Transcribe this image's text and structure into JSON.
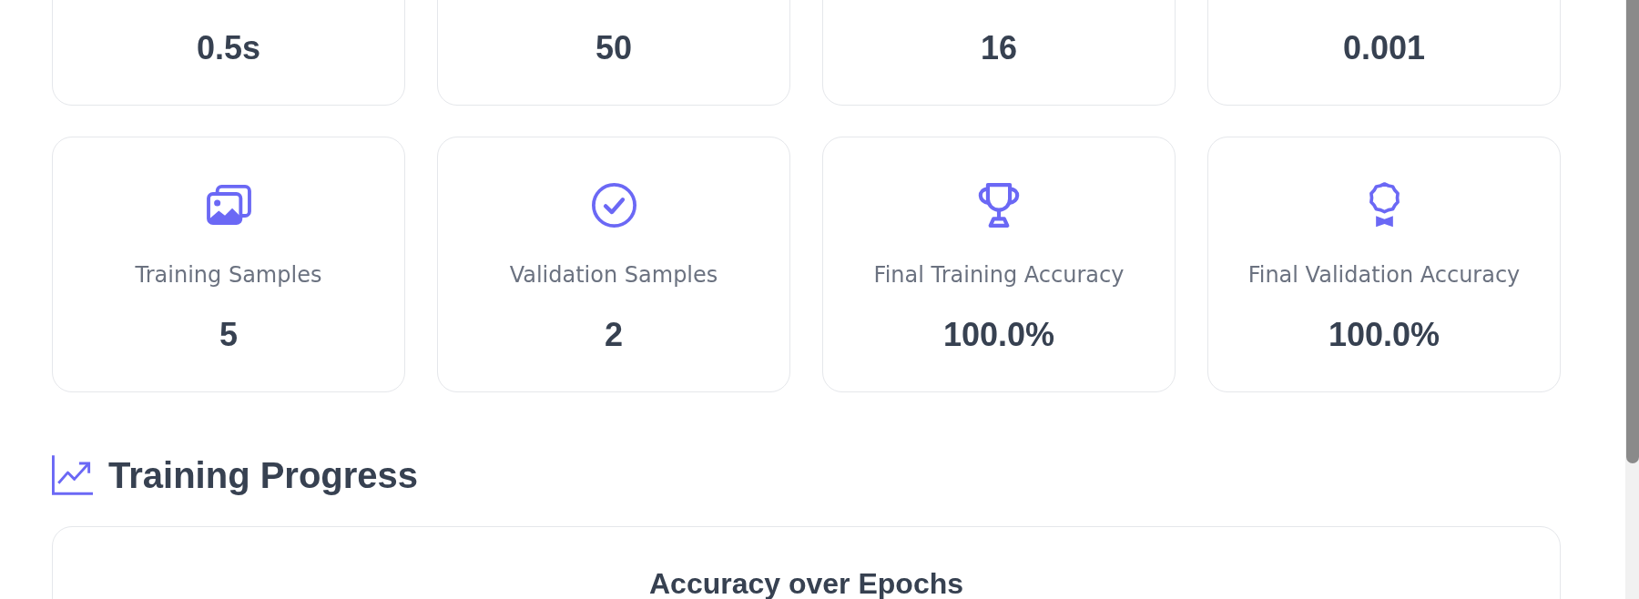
{
  "stat_cards_row_1": [
    {
      "value": "0.5s"
    },
    {
      "value": "50"
    },
    {
      "value": "16"
    },
    {
      "value": "0.001"
    }
  ],
  "stat_cards_row_2": [
    {
      "label": "Training Samples",
      "value": "5"
    },
    {
      "label": "Validation Samples",
      "value": "2"
    },
    {
      "label": "Final Training Accuracy",
      "value": "100.0%"
    },
    {
      "label": "Final Validation Accuracy",
      "value": "100.0%"
    }
  ],
  "training_progress": {
    "heading": "Training Progress",
    "chart_card": {
      "title": "Accuracy over Epochs"
    }
  }
}
